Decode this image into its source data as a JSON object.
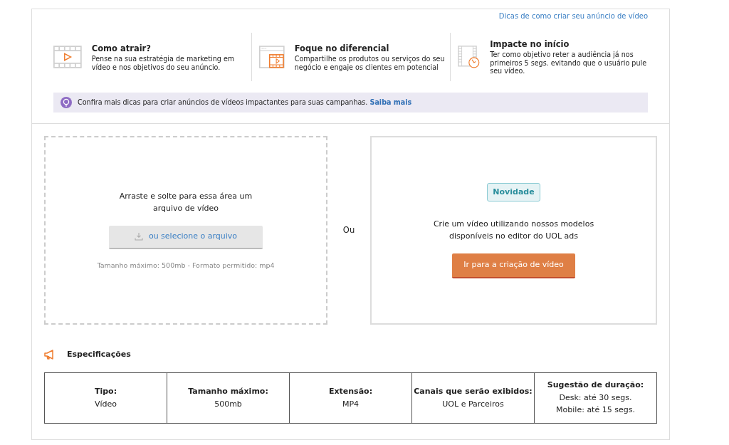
{
  "help_link": "Dicas de como criar seu anúncio de vídeo",
  "tips": [
    {
      "kind": "film",
      "title": "Como atrair?",
      "text": "Pense na sua estratégia de marketing em vídeo e nos objetivos do seu anúncio."
    },
    {
      "kind": "browser",
      "title": "Foque no diferencial",
      "text": "Compartilhe os produtos ou serviços do seu negócio e engaje os clientes em potencial"
    },
    {
      "kind": "clock",
      "title": "Impacte no início",
      "text": "Ter como objetivo reter a audiência já nos primeiros 5 segs. evitando que o usuário pule seu vídeo."
    }
  ],
  "banner": {
    "text": "Confira mais dicas para criar anúncios de vídeos impactantes para suas campanhas.",
    "link": "Saiba mais"
  },
  "upload": {
    "instruction": "Arraste e solte para essa área um arquivo de vídeo",
    "button": "ou selecione o arquivo",
    "hint": "Tamanho máximo: 500mb - Formato permitido: mp4"
  },
  "separator": "Ou",
  "create": {
    "badge": "Novidade",
    "text": "Crie um vídeo utilizando nossos modelos disponíveis no editor do UOL ads",
    "button": "Ir para a criação de vídeo"
  },
  "specs": {
    "title": "Especificações",
    "columns": [
      {
        "label": "Tipo:",
        "values": [
          "Vídeo"
        ]
      },
      {
        "label": "Tamanho máximo:",
        "values": [
          "500mb"
        ]
      },
      {
        "label": "Extensão:",
        "values": [
          "MP4"
        ]
      },
      {
        "label": "Canais que serão exibidos:",
        "values": [
          "UOL e Parceiros"
        ]
      },
      {
        "label": "Sugestão de duração:",
        "values": [
          "Desk: até 30 segs.",
          "Mobile: até 15 segs."
        ]
      }
    ]
  }
}
